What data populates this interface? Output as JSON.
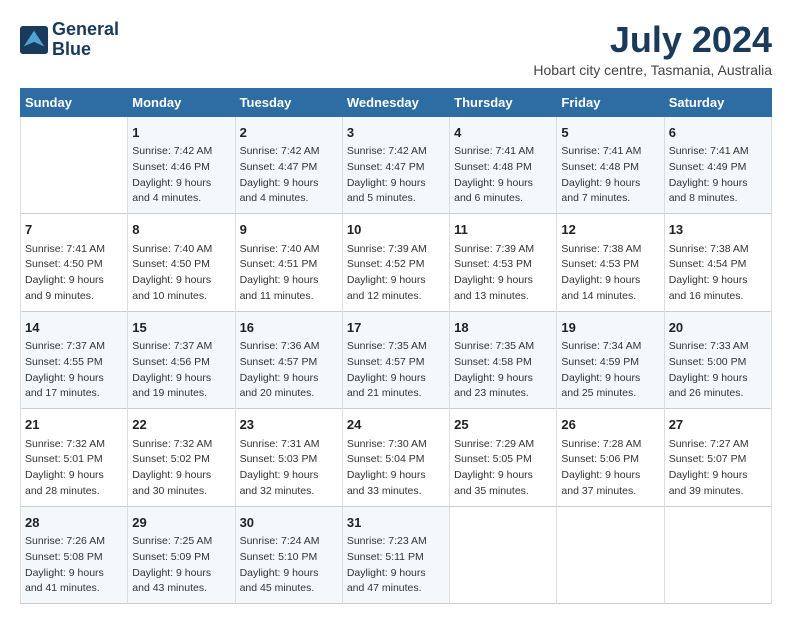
{
  "logo": {
    "line1": "General",
    "line2": "Blue"
  },
  "title": "July 2024",
  "location": "Hobart city centre, Tasmania, Australia",
  "weekdays": [
    "Sunday",
    "Monday",
    "Tuesday",
    "Wednesday",
    "Thursday",
    "Friday",
    "Saturday"
  ],
  "weeks": [
    [
      {
        "day": "",
        "info": ""
      },
      {
        "day": "1",
        "info": "Sunrise: 7:42 AM\nSunset: 4:46 PM\nDaylight: 9 hours\nand 4 minutes."
      },
      {
        "day": "2",
        "info": "Sunrise: 7:42 AM\nSunset: 4:47 PM\nDaylight: 9 hours\nand 4 minutes."
      },
      {
        "day": "3",
        "info": "Sunrise: 7:42 AM\nSunset: 4:47 PM\nDaylight: 9 hours\nand 5 minutes."
      },
      {
        "day": "4",
        "info": "Sunrise: 7:41 AM\nSunset: 4:48 PM\nDaylight: 9 hours\nand 6 minutes."
      },
      {
        "day": "5",
        "info": "Sunrise: 7:41 AM\nSunset: 4:48 PM\nDaylight: 9 hours\nand 7 minutes."
      },
      {
        "day": "6",
        "info": "Sunrise: 7:41 AM\nSunset: 4:49 PM\nDaylight: 9 hours\nand 8 minutes."
      }
    ],
    [
      {
        "day": "7",
        "info": "Sunrise: 7:41 AM\nSunset: 4:50 PM\nDaylight: 9 hours\nand 9 minutes."
      },
      {
        "day": "8",
        "info": "Sunrise: 7:40 AM\nSunset: 4:50 PM\nDaylight: 9 hours\nand 10 minutes."
      },
      {
        "day": "9",
        "info": "Sunrise: 7:40 AM\nSunset: 4:51 PM\nDaylight: 9 hours\nand 11 minutes."
      },
      {
        "day": "10",
        "info": "Sunrise: 7:39 AM\nSunset: 4:52 PM\nDaylight: 9 hours\nand 12 minutes."
      },
      {
        "day": "11",
        "info": "Sunrise: 7:39 AM\nSunset: 4:53 PM\nDaylight: 9 hours\nand 13 minutes."
      },
      {
        "day": "12",
        "info": "Sunrise: 7:38 AM\nSunset: 4:53 PM\nDaylight: 9 hours\nand 14 minutes."
      },
      {
        "day": "13",
        "info": "Sunrise: 7:38 AM\nSunset: 4:54 PM\nDaylight: 9 hours\nand 16 minutes."
      }
    ],
    [
      {
        "day": "14",
        "info": "Sunrise: 7:37 AM\nSunset: 4:55 PM\nDaylight: 9 hours\nand 17 minutes."
      },
      {
        "day": "15",
        "info": "Sunrise: 7:37 AM\nSunset: 4:56 PM\nDaylight: 9 hours\nand 19 minutes."
      },
      {
        "day": "16",
        "info": "Sunrise: 7:36 AM\nSunset: 4:57 PM\nDaylight: 9 hours\nand 20 minutes."
      },
      {
        "day": "17",
        "info": "Sunrise: 7:35 AM\nSunset: 4:57 PM\nDaylight: 9 hours\nand 21 minutes."
      },
      {
        "day": "18",
        "info": "Sunrise: 7:35 AM\nSunset: 4:58 PM\nDaylight: 9 hours\nand 23 minutes."
      },
      {
        "day": "19",
        "info": "Sunrise: 7:34 AM\nSunset: 4:59 PM\nDaylight: 9 hours\nand 25 minutes."
      },
      {
        "day": "20",
        "info": "Sunrise: 7:33 AM\nSunset: 5:00 PM\nDaylight: 9 hours\nand 26 minutes."
      }
    ],
    [
      {
        "day": "21",
        "info": "Sunrise: 7:32 AM\nSunset: 5:01 PM\nDaylight: 9 hours\nand 28 minutes."
      },
      {
        "day": "22",
        "info": "Sunrise: 7:32 AM\nSunset: 5:02 PM\nDaylight: 9 hours\nand 30 minutes."
      },
      {
        "day": "23",
        "info": "Sunrise: 7:31 AM\nSunset: 5:03 PM\nDaylight: 9 hours\nand 32 minutes."
      },
      {
        "day": "24",
        "info": "Sunrise: 7:30 AM\nSunset: 5:04 PM\nDaylight: 9 hours\nand 33 minutes."
      },
      {
        "day": "25",
        "info": "Sunrise: 7:29 AM\nSunset: 5:05 PM\nDaylight: 9 hours\nand 35 minutes."
      },
      {
        "day": "26",
        "info": "Sunrise: 7:28 AM\nSunset: 5:06 PM\nDaylight: 9 hours\nand 37 minutes."
      },
      {
        "day": "27",
        "info": "Sunrise: 7:27 AM\nSunset: 5:07 PM\nDaylight: 9 hours\nand 39 minutes."
      }
    ],
    [
      {
        "day": "28",
        "info": "Sunrise: 7:26 AM\nSunset: 5:08 PM\nDaylight: 9 hours\nand 41 minutes."
      },
      {
        "day": "29",
        "info": "Sunrise: 7:25 AM\nSunset: 5:09 PM\nDaylight: 9 hours\nand 43 minutes."
      },
      {
        "day": "30",
        "info": "Sunrise: 7:24 AM\nSunset: 5:10 PM\nDaylight: 9 hours\nand 45 minutes."
      },
      {
        "day": "31",
        "info": "Sunrise: 7:23 AM\nSunset: 5:11 PM\nDaylight: 9 hours\nand 47 minutes."
      },
      {
        "day": "",
        "info": ""
      },
      {
        "day": "",
        "info": ""
      },
      {
        "day": "",
        "info": ""
      }
    ]
  ]
}
